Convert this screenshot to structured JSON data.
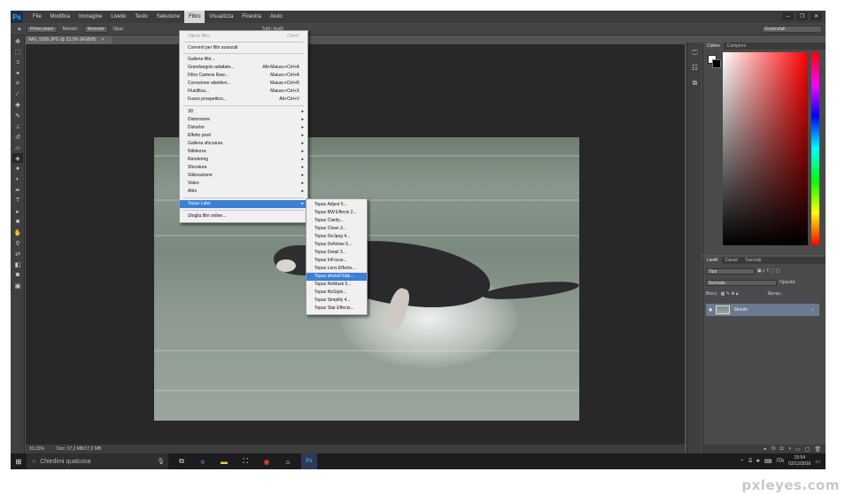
{
  "app": {
    "logo": "Ps"
  },
  "menubar": {
    "items": [
      "File",
      "Modifica",
      "Immagine",
      "Livello",
      "Testo",
      "Selezione",
      "Filtro",
      "Visualizza",
      "Finestra",
      "Aiuto"
    ],
    "active_index": 6
  },
  "window_controls": {
    "minimize": "‒",
    "restore": "❐",
    "close": "✕"
  },
  "options": {
    "sample": "Primo piano",
    "mode_label": "Metodo:",
    "mode_value": "Normale",
    "opacity_label": "Opac",
    "all_layers": "Tutti i livelli",
    "workspace": "Essenziali"
  },
  "document": {
    "tab_title": "IMG_5095.JPG @ 33,3% (RGB/8)",
    "tab_close": "×",
    "status_zoom": "33,33%",
    "status_doc": "Doc: 17,2 MB/17,2 MB"
  },
  "filter_menu": {
    "items": [
      {
        "label": "Ultimo filtro",
        "shortcut": "Ctrl+F",
        "disabled": true
      },
      {
        "label": "Converti per filtri avanzati"
      },
      {
        "label": "Galleria filtri..."
      },
      {
        "label": "Grandangolo adattato...",
        "shortcut": "Alt+Maiusc+Ctrl+A"
      },
      {
        "label": "Filtro Camera Raw...",
        "shortcut": "Maiusc+Ctrl+A"
      },
      {
        "label": "Correzione obiettivo...",
        "shortcut": "Maiusc+Ctrl+R"
      },
      {
        "label": "Fluidifica...",
        "shortcut": "Maiusc+Ctrl+X"
      },
      {
        "label": "Fuoco prospettico...",
        "shortcut": "Alt+Ctrl+V"
      },
      {
        "label": "3D",
        "submenu": true
      },
      {
        "label": "Distorsione",
        "submenu": true
      },
      {
        "label": "Disturbo",
        "submenu": true
      },
      {
        "label": "Effetto pixel",
        "submenu": true
      },
      {
        "label": "Galleria sfocatura",
        "submenu": true
      },
      {
        "label": "Nitidezza",
        "submenu": true
      },
      {
        "label": "Rendering",
        "submenu": true
      },
      {
        "label": "Sfocatura",
        "submenu": true
      },
      {
        "label": "Stilizzazione",
        "submenu": true
      },
      {
        "label": "Video",
        "submenu": true
      },
      {
        "label": "Altro",
        "submenu": true
      },
      {
        "label": "Topaz Labs",
        "submenu": true,
        "highlight": true
      },
      {
        "label": "Sfoglia filtri online..."
      }
    ],
    "arrow": "▸"
  },
  "topaz_menu": {
    "items": [
      "Topaz Adjust 5...",
      "Topaz BW Effects 2...",
      "Topaz Clarity...",
      "Topaz Clean 3...",
      "Topaz DeJpeg 4...",
      "Topaz DeNoise 5...",
      "Topaz Detail 3...",
      "Topaz InFocus...",
      "Topaz Lens Effects...",
      "Topaz photoFXlab...",
      "Topaz ReMask 5...",
      "Topaz ReStyle...",
      "Topaz Simplify 4...",
      "Topaz Star Effects..."
    ],
    "highlight_index": 9
  },
  "color_panel": {
    "tabs": [
      "Colore",
      "Campioni"
    ],
    "foreground": "#ffffff",
    "background": "#000000"
  },
  "layers_panel": {
    "tabs": [
      "Livelli",
      "Canali",
      "Tracciati"
    ],
    "filter": "Tipo",
    "blend_mode": "Normale",
    "opacity_label": "Opacità:",
    "lock_label": "Blocc:",
    "fill_label": "Riemp.:",
    "layer_name": "Sfondo"
  },
  "taskbar": {
    "search_placeholder": "Chiedimi qualcosa",
    "language": "ITA",
    "time": "15:54",
    "date": "02/12/2016"
  },
  "watermark": "pxleyes.com"
}
